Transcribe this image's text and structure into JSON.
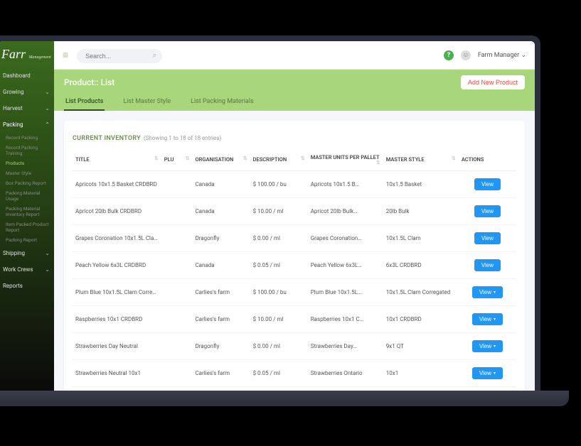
{
  "brand": {
    "name": "Farr",
    "sub": "Management"
  },
  "sidebar": {
    "items": [
      {
        "label": "Dashboard",
        "chev": ""
      },
      {
        "label": "Growing",
        "chev": "⌄"
      },
      {
        "label": "Harvest",
        "chev": "⌄"
      },
      {
        "label": "Packing",
        "chev": "⌃",
        "active": true,
        "subs": [
          {
            "label": "Record Packing"
          },
          {
            "label": "Record Packing Training"
          },
          {
            "label": "Products",
            "active": true
          },
          {
            "label": "Master Style"
          },
          {
            "label": "Box Packing Report"
          },
          {
            "label": "Packing Material Usage"
          },
          {
            "label": "Packing Material Inventory Report"
          },
          {
            "label": "Item Packed Product Report"
          },
          {
            "label": "Packing Report"
          }
        ]
      },
      {
        "label": "Shipping",
        "chev": "⌄"
      },
      {
        "label": "Work Crews",
        "chev": "⌄"
      },
      {
        "label": "Reports",
        "chev": ""
      }
    ]
  },
  "topbar": {
    "search_placeholder": "Search...",
    "help": "?",
    "user_name": "Farm Manager",
    "user_caret": "⌄"
  },
  "page": {
    "title": "Product:: List",
    "add_button": "Add New  Product",
    "tabs": [
      {
        "label": "List Products",
        "active": true
      },
      {
        "label": "List  Master Style"
      },
      {
        "label": "List Packing Materials"
      }
    ]
  },
  "inventory": {
    "heading": "CURRENT INVENTORY",
    "showing": "(Showing 1 to 18 of 18 entries)",
    "columns": {
      "title": "TITLE",
      "plu": "PLU",
      "org": "ORGANISATION",
      "desc": "DESCRIPTION",
      "mu": "MASTER UNITS PER PALLET",
      "ms": "MASTER STYLE",
      "act": "ACTIONS"
    },
    "view_label": "View",
    "rows": [
      {
        "title": "Apricots 10x1.5 Basket CRDBRD",
        "plu": "",
        "org": "Canada",
        "desc": "$ 100.00 / bu",
        "mu": "Apricots 10x1.5 B…",
        "ms": "10x1.5 Basket",
        "caret": false
      },
      {
        "title": "Apricot 20lb Bulk CRDBRD",
        "plu": "",
        "org": "Canada",
        "desc": "$ 10.00 / ml",
        "mu": "Apricot 20lb Bulk…",
        "ms": "20lb Bulk",
        "caret": false
      },
      {
        "title": "Grapes Coronation 10x1.5L Clam",
        "plu": "",
        "org": "Dragonfly",
        "desc": "$ 0.00 / ml",
        "mu": "Grapes Coronation…",
        "ms": "10x1.5L Clam",
        "caret": false
      },
      {
        "title": "Peach Yellow 6x3L CRDBRD",
        "plu": "",
        "org": "Canada",
        "desc": "$ 0.05 / ml",
        "mu": "Peach Yellow 6x3L…",
        "ms": "6x3L CRDBRD",
        "caret": false
      },
      {
        "title": "Plum Blue 10x1.5L Clam Corregated",
        "plu": "",
        "org": "Carlies's farm",
        "desc": "$ 100.00 / bu",
        "mu": "Plum Blue 10x1.5L…",
        "ms": "10x1.5L Clam Corregated",
        "caret": true
      },
      {
        "title": "Raspberries 10x1 CRDBRD",
        "plu": "",
        "org": "Carlies's farm",
        "desc": "$ 10.00 / ml",
        "mu": "Raspberries 10x1 C…",
        "ms": "10x1 CRDBRD",
        "caret": true
      },
      {
        "title": "Strawberries Day Neutral",
        "plu": "",
        "org": "Dragonfly",
        "desc": "$ 0.00 / ml",
        "mu": "Strawberries Day…",
        "ms": "9x1 QT",
        "caret": true
      },
      {
        "title": "Strawberries Neutral 10x1",
        "plu": "",
        "org": "Carlies's farm",
        "desc": "$ 0.05 / ml",
        "mu": "Strawberries Ontario",
        "ms": "10x1",
        "caret": true
      }
    ]
  }
}
